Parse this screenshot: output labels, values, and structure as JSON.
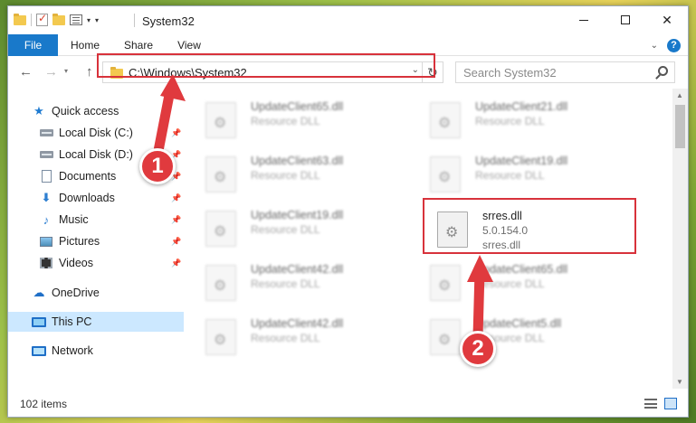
{
  "window": {
    "title": "System32",
    "controls": {
      "minimize": "minimize",
      "maximize": "maximize",
      "close": "✕"
    }
  },
  "ribbon": {
    "tabs": [
      "File",
      "Home",
      "Share",
      "View"
    ],
    "help": "?"
  },
  "navigation": {
    "address": "C:\\Windows\\System32",
    "search_placeholder": "Search System32"
  },
  "sidebar": {
    "items": [
      {
        "label": "Quick access",
        "icon": "star-icon",
        "pinned": false
      },
      {
        "label": "Local Disk (C:)",
        "icon": "disk-icon",
        "pinned": true
      },
      {
        "label": "Local Disk (D:)",
        "icon": "disk-icon",
        "pinned": true
      },
      {
        "label": "Documents",
        "icon": "document-icon",
        "pinned": true
      },
      {
        "label": "Downloads",
        "icon": "download-icon",
        "pinned": true
      },
      {
        "label": "Music",
        "icon": "music-icon",
        "pinned": true
      },
      {
        "label": "Pictures",
        "icon": "pictures-icon",
        "pinned": true
      },
      {
        "label": "Videos",
        "icon": "videos-icon",
        "pinned": true
      },
      {
        "label": "OneDrive",
        "icon": "onedrive-icon",
        "pinned": false
      },
      {
        "label": "This PC",
        "icon": "computer-icon",
        "pinned": false,
        "selected": true
      },
      {
        "label": "Network",
        "icon": "network-icon",
        "pinned": false
      }
    ]
  },
  "files": [
    {
      "name": "UpdateClient65.dll",
      "type": "Resource DLL"
    },
    {
      "name": "UpdateClient21.dll",
      "type": "Resource DLL"
    },
    {
      "name": "UpdateClient63.dll",
      "type": "Resource DLL"
    },
    {
      "name": "UpdateClient19.dll",
      "type": "Resource DLL"
    },
    {
      "name": "UpdateClient19.dll",
      "type": "Resource DLL"
    },
    {
      "name": "srres.dll",
      "version": "5.0.154.0",
      "type": "srres.dll",
      "highlighted": true
    },
    {
      "name": "UpdateClient42.dll",
      "type": "Resource DLL"
    },
    {
      "name": "UpdateClient65.dll",
      "type": "Resource DLL"
    },
    {
      "name": "UpdateClient42.dll",
      "type": "Resource DLL"
    },
    {
      "name": "UpdateClient5.dll",
      "type": "Resource DLL"
    }
  ],
  "status": {
    "item_count": "102 items"
  },
  "annotations": {
    "step1": "1",
    "step2": "2",
    "color": "#e03a3e"
  }
}
